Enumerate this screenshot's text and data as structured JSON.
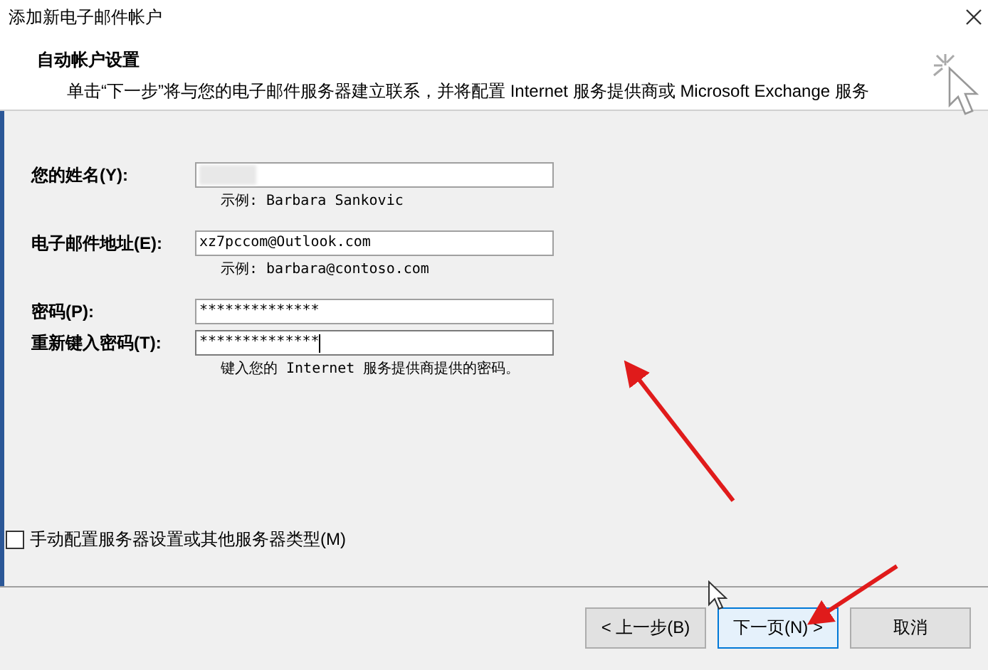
{
  "window": {
    "title": "添加新电子邮件帐户"
  },
  "header": {
    "title": "自动帐户设置",
    "description": "单击“下一步”将与您的电子邮件服务器建立联系，并将配置 Internet 服务提供商或 Microsoft Exchange 服务"
  },
  "fields": [
    {
      "label": "您的姓名(Y):",
      "redacted": true,
      "hint": "示例: Barbara Sankovic"
    },
    {
      "label": "电子邮件地址(E):",
      "value": "xz7pccom@Outlook.com",
      "redacted": false,
      "hint": "示例: barbara@contoso.com"
    },
    {
      "label": "密码(P):",
      "value": "**************",
      "redacted": false
    },
    {
      "label": "重新键入密码(T):",
      "value": "**************",
      "redacted": false,
      "focused": true,
      "hint": "键入您的 Internet 服务提供商提供的密码。"
    }
  ],
  "manual_option": {
    "label": "手动配置服务器设置或其他服务器类型(M)",
    "checked": false
  },
  "buttons": [
    {
      "label": "< 上一步(B)",
      "default": false
    },
    {
      "label": "下一页(N) >",
      "default": true
    },
    {
      "label": "取消",
      "default": false
    }
  ]
}
